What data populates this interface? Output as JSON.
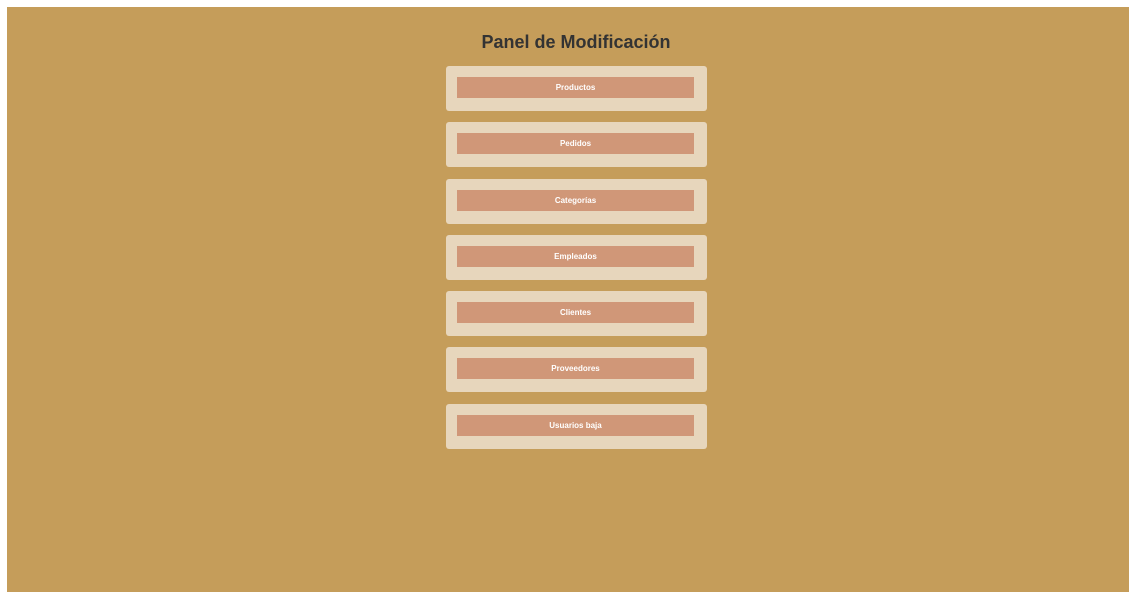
{
  "page": {
    "title": "Panel de Modificación"
  },
  "menu": {
    "items": [
      {
        "label": "Productos"
      },
      {
        "label": "Pedidos"
      },
      {
        "label": "Categorías"
      },
      {
        "label": "Empleados"
      },
      {
        "label": "Clientes"
      },
      {
        "label": "Proveedores"
      },
      {
        "label": "Usuarios baja"
      }
    ]
  },
  "colors": {
    "background": "#c59d5a",
    "card": "#e7d6bc",
    "button": "#d09778",
    "button_text": "#ffffff",
    "title_text": "#333333"
  }
}
